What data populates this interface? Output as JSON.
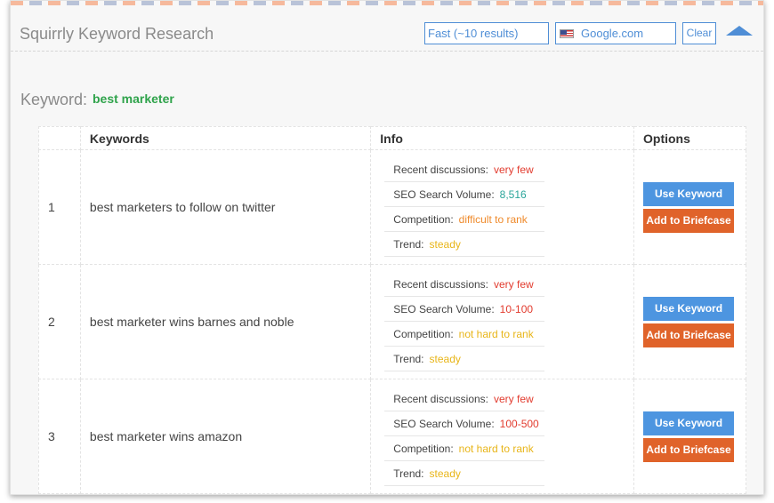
{
  "header": {
    "title": "Squirrly Keyword Research",
    "mode_select": "Fast (~10 results)",
    "engine_select": "Google.com",
    "clear_label": "Clear"
  },
  "keyword": {
    "label": "Keyword:",
    "value": "best marketer"
  },
  "table": {
    "columns": [
      "",
      "Keywords",
      "Info",
      "Options"
    ],
    "rows": [
      {
        "num": "1",
        "keyword": "best marketers to follow on twitter",
        "info": [
          {
            "label": "Recent discussions:",
            "value": "very few",
            "color": "#e23b2e"
          },
          {
            "label": "SEO Search Volume:",
            "value": "8,516",
            "color": "#2aa59a"
          },
          {
            "label": "Competition:",
            "value": "difficult to rank",
            "color": "#ef8a2b"
          },
          {
            "label": "Trend:",
            "value": "steady",
            "color": "#e8b518"
          }
        ],
        "use_label": "Use Keyword",
        "brief_label": "Add to Briefcase"
      },
      {
        "num": "2",
        "keyword": "best marketer wins barnes and noble",
        "info": [
          {
            "label": "Recent discussions:",
            "value": "very few",
            "color": "#e23b2e"
          },
          {
            "label": "SEO Search Volume:",
            "value": "10-100",
            "color": "#e23b2e"
          },
          {
            "label": "Competition:",
            "value": "not hard to rank",
            "color": "#e8b518"
          },
          {
            "label": "Trend:",
            "value": "steady",
            "color": "#e8b518"
          }
        ],
        "use_label": "Use Keyword",
        "brief_label": "Add to Briefcase"
      },
      {
        "num": "3",
        "keyword": "best marketer wins amazon",
        "info": [
          {
            "label": "Recent discussions:",
            "value": "very few",
            "color": "#e23b2e"
          },
          {
            "label": "SEO Search Volume:",
            "value": "100-500",
            "color": "#e23b2e"
          },
          {
            "label": "Competition:",
            "value": "not hard to rank",
            "color": "#e8b518"
          },
          {
            "label": "Trend:",
            "value": "steady",
            "color": "#e8b518"
          }
        ],
        "use_label": "Use Keyword",
        "brief_label": "Add to Briefcase"
      }
    ]
  },
  "colors": {
    "accent_blue": "#4d95e0",
    "accent_orange": "#e0632a",
    "keyword_green": "#2fa34b"
  }
}
